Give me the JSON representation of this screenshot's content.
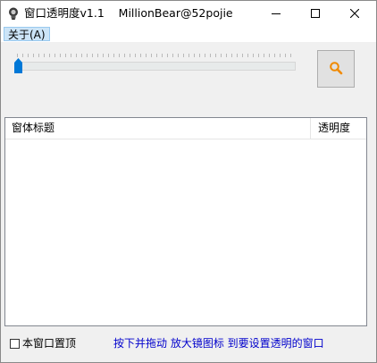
{
  "window": {
    "title": "窗口透明度v1.1    MillionBear@52pojie"
  },
  "titlebar_icons": {
    "app": "app-bulb-icon",
    "minimize": "minimize-icon",
    "maximize": "maximize-icon",
    "close": "close-icon"
  },
  "menu": {
    "items": [
      {
        "label": "关于(A)"
      }
    ]
  },
  "slider": {
    "value_fraction": 0.0
  },
  "magnifier": {
    "icon": "magnifier-icon",
    "accent_color": "#f08a00"
  },
  "list": {
    "columns": [
      {
        "label": "窗体标题"
      },
      {
        "label": "透明度"
      }
    ],
    "rows": []
  },
  "footer": {
    "topmost_checkbox": {
      "label": "本窗口置顶",
      "checked": false
    },
    "hint": "按下并拖动 放大镜图标 到要设置透明的窗口",
    "hint_color": "#0000cc"
  }
}
